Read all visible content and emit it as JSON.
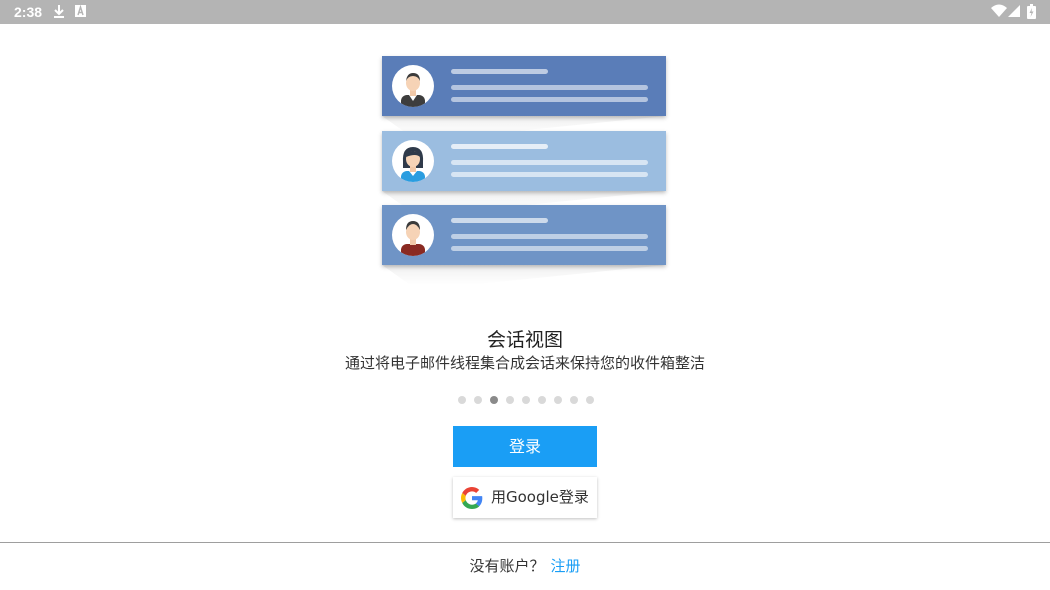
{
  "status_bar": {
    "time": "2:38"
  },
  "onboarding": {
    "title": "会话视图",
    "subtitle": "通过将电子邮件线程集合成会话来保持您的收件箱整洁",
    "page_count": 9,
    "active_page": 3
  },
  "buttons": {
    "login": "登录",
    "google_login": "用Google登录"
  },
  "footer": {
    "no_account": "没有账户？",
    "register": "注册"
  },
  "colors": {
    "accent": "#1a9ef5",
    "status_bar": "#b4b4b4",
    "card_dark": "#5a7db8",
    "card_light": "#9bbde0",
    "card_mid": "#6f94c6"
  }
}
